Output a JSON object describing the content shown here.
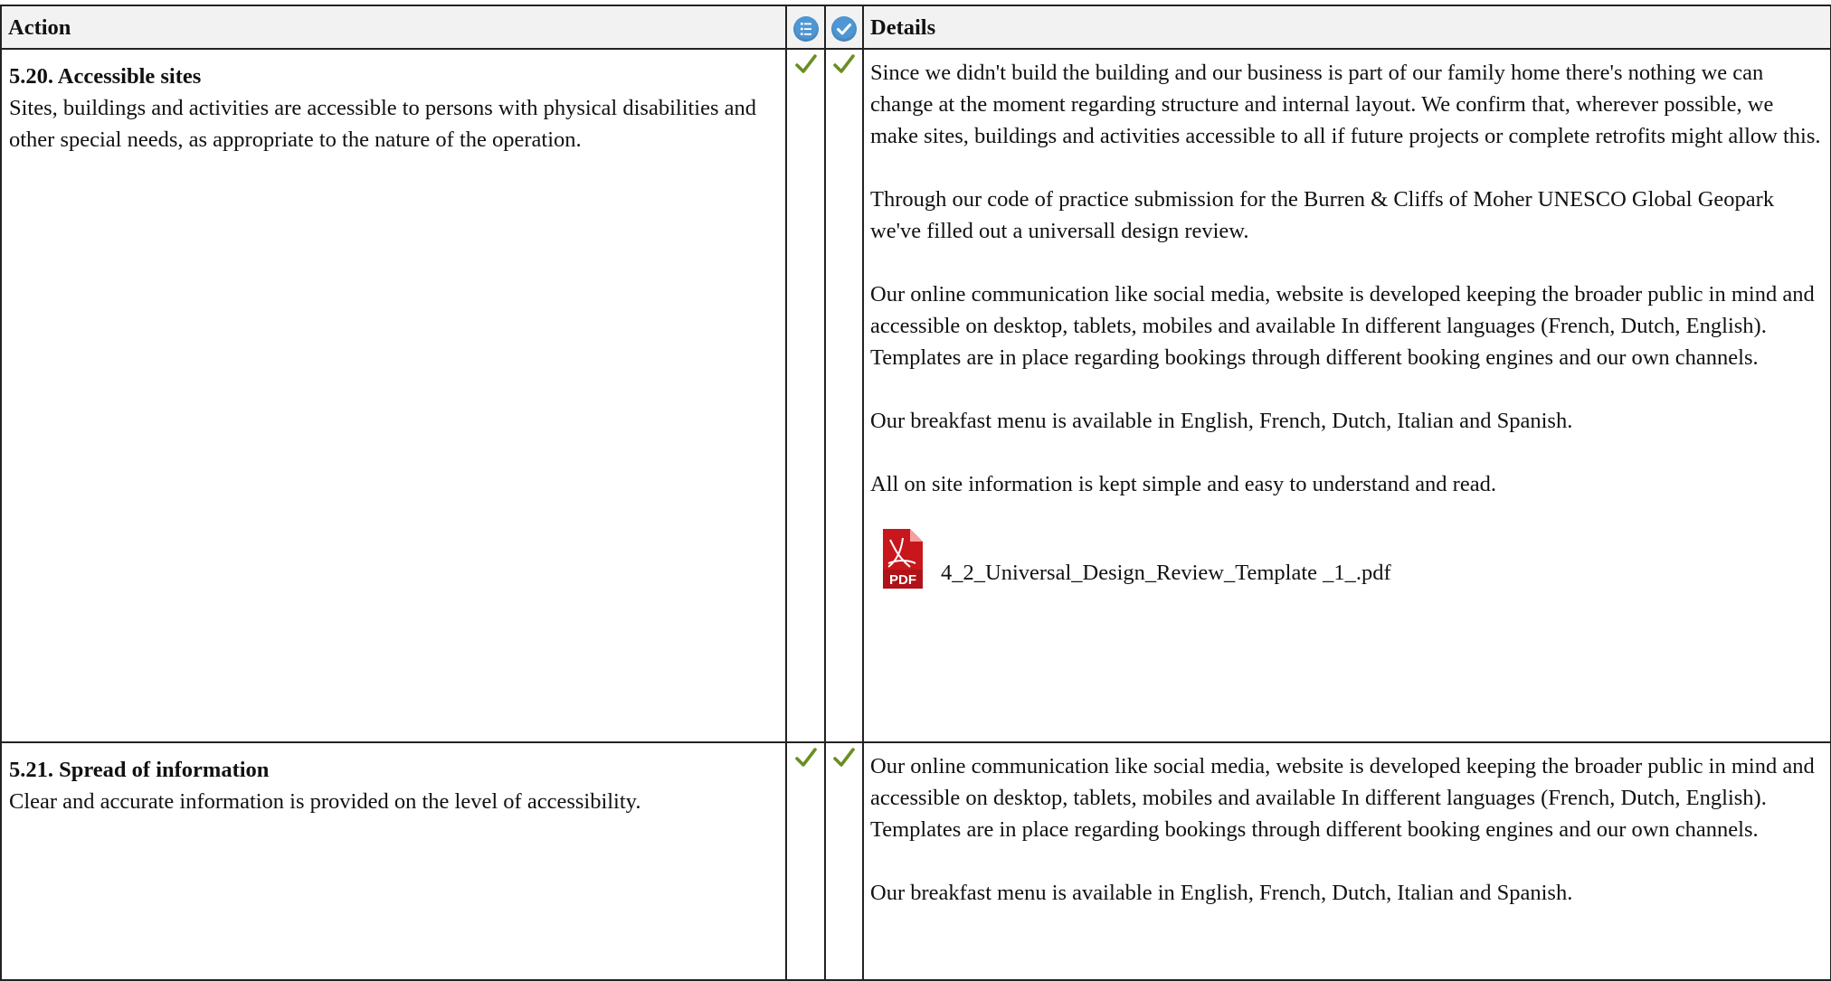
{
  "header": {
    "action": "Action",
    "details": "Details",
    "icon1": "list-icon",
    "icon2": "checkmark-circle-icon"
  },
  "rows": [
    {
      "title": "5.20. Accessible sites",
      "description": "Sites, buildings and activities are accessible to persons with physical disabilities and other special needs, as appropriate to the nature of the operation.",
      "check1": "checkmark-icon",
      "check2": "checkmark-icon",
      "paragraphs": [
        "Since we didn't build the building and our business is part of our family home there's nothing we can change at the moment regarding structure and internal layout. We confirm that, wherever possible, we make sites, buildings and activities accessible to all if future projects or complete retrofits might allow this.",
        "Through our code of practice submission for the Burren & Cliffs of Moher UNESCO Global Geopark we've filled out a universall design review.",
        "Our online communication like social media, website is developed keeping the broader public in mind and accessible on desktop, tablets, mobiles and available In different languages (French, Dutch, English). Templates are in place regarding bookings through different booking engines and our own channels.",
        "Our breakfast menu is available in English, French, Dutch, Italian and Spanish.",
        "All on site information is kept simple and easy to understand and read."
      ],
      "attachment": {
        "label": "PDF",
        "filename": "4_2_Universal_Design_Review_Template _1_.pdf"
      }
    },
    {
      "title": "5.21. Spread of information",
      "description": "Clear and accurate information is provided on the level of accessibility.",
      "check1": "checkmark-icon",
      "check2": "checkmark-icon",
      "paragraphs": [
        "Our online communication like social media, website is developed keeping the broader public in mind and accessible on desktop, tablets, mobiles and available In different languages (French, Dutch, English). Templates are in place regarding bookings through different booking engines and our own channels.",
        "Our breakfast menu is available in English, French, Dutch, Italian and Spanish."
      ]
    }
  ],
  "colors": {
    "check": "#6b8e23",
    "header_bg": "#f2f2f2",
    "icon_blue": "#4f97d4",
    "pdf_red": "#c8161d"
  }
}
